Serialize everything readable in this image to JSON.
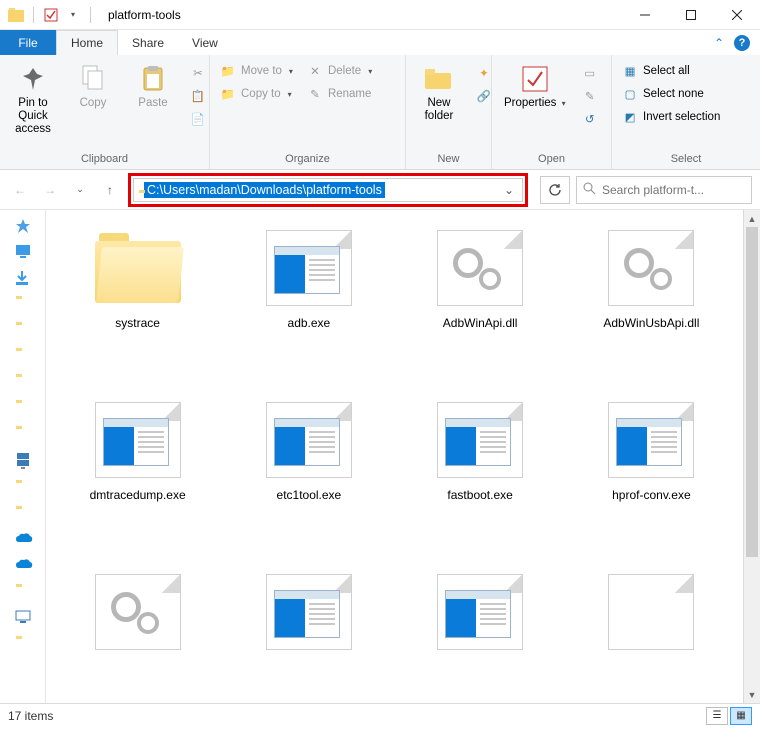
{
  "window": {
    "title": "platform-tools"
  },
  "tabs": {
    "file": "File",
    "home": "Home",
    "share": "Share",
    "view": "View"
  },
  "ribbon": {
    "clipboard": {
      "label": "Clipboard",
      "pin": "Pin to Quick access",
      "copy": "Copy",
      "paste": "Paste"
    },
    "organize": {
      "label": "Organize",
      "moveto": "Move to",
      "copyto": "Copy to",
      "delete": "Delete",
      "rename": "Rename"
    },
    "new": {
      "label": "New",
      "newfolder": "New folder"
    },
    "open": {
      "label": "Open",
      "properties": "Properties"
    },
    "select": {
      "label": "Select",
      "all": "Select all",
      "none": "Select none",
      "invert": "Invert selection"
    }
  },
  "address": {
    "path": "C:\\Users\\madan\\Downloads\\platform-tools"
  },
  "search": {
    "placeholder": "Search platform-t..."
  },
  "files": [
    {
      "name": "systrace",
      "type": "folder"
    },
    {
      "name": "adb.exe",
      "type": "exe"
    },
    {
      "name": "AdbWinApi.dll",
      "type": "dll"
    },
    {
      "name": "AdbWinUsbApi.dll",
      "type": "dll"
    },
    {
      "name": "dmtracedump.exe",
      "type": "exe"
    },
    {
      "name": "etc1tool.exe",
      "type": "exe"
    },
    {
      "name": "fastboot.exe",
      "type": "exe"
    },
    {
      "name": "hprof-conv.exe",
      "type": "exe"
    },
    {
      "name": "",
      "type": "dll"
    },
    {
      "name": "",
      "type": "exe"
    },
    {
      "name": "",
      "type": "exe"
    },
    {
      "name": "",
      "type": "blank"
    }
  ],
  "status": {
    "count": "17 items"
  }
}
